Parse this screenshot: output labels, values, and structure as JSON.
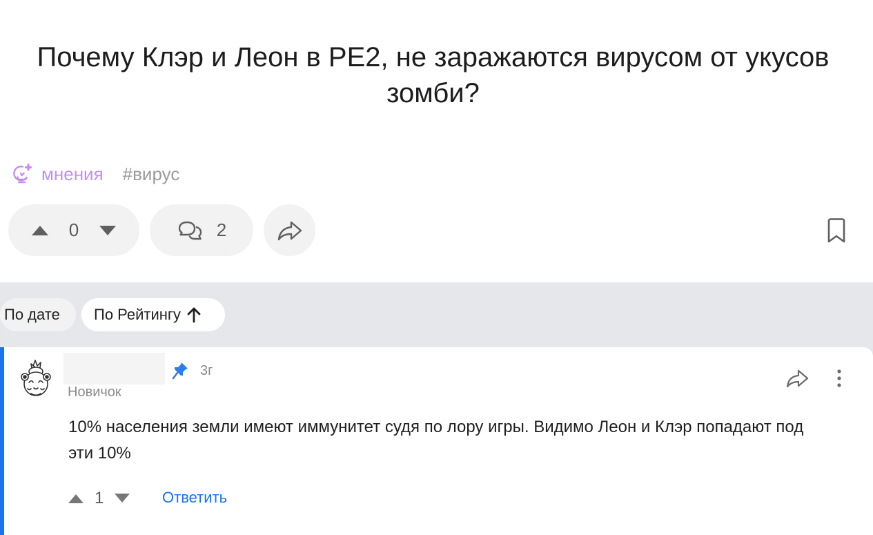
{
  "question": {
    "title": "Почему Клэр и Леон в РЕ2, не заражаются вирусом от укусов зомби?"
  },
  "tags": {
    "category": {
      "label": "мнения",
      "icon": "lightbulb-sparkle-icon",
      "color": "#c38ef0"
    },
    "hashtag": "#вирус"
  },
  "actions": {
    "vote_count": "0",
    "comment_count": "2"
  },
  "sort": {
    "by_date": "По дате",
    "by_rating": "По Рейтингу"
  },
  "comment": {
    "time": "3г",
    "rank": "Новичок",
    "text": "10% населения земли имеют иммунитет судя по лору игры. Видимо Леон и Клэр попадают под эти 10%",
    "vote_count": "1",
    "reply_label": "Ответить",
    "accent_color": "#1a73e8"
  }
}
